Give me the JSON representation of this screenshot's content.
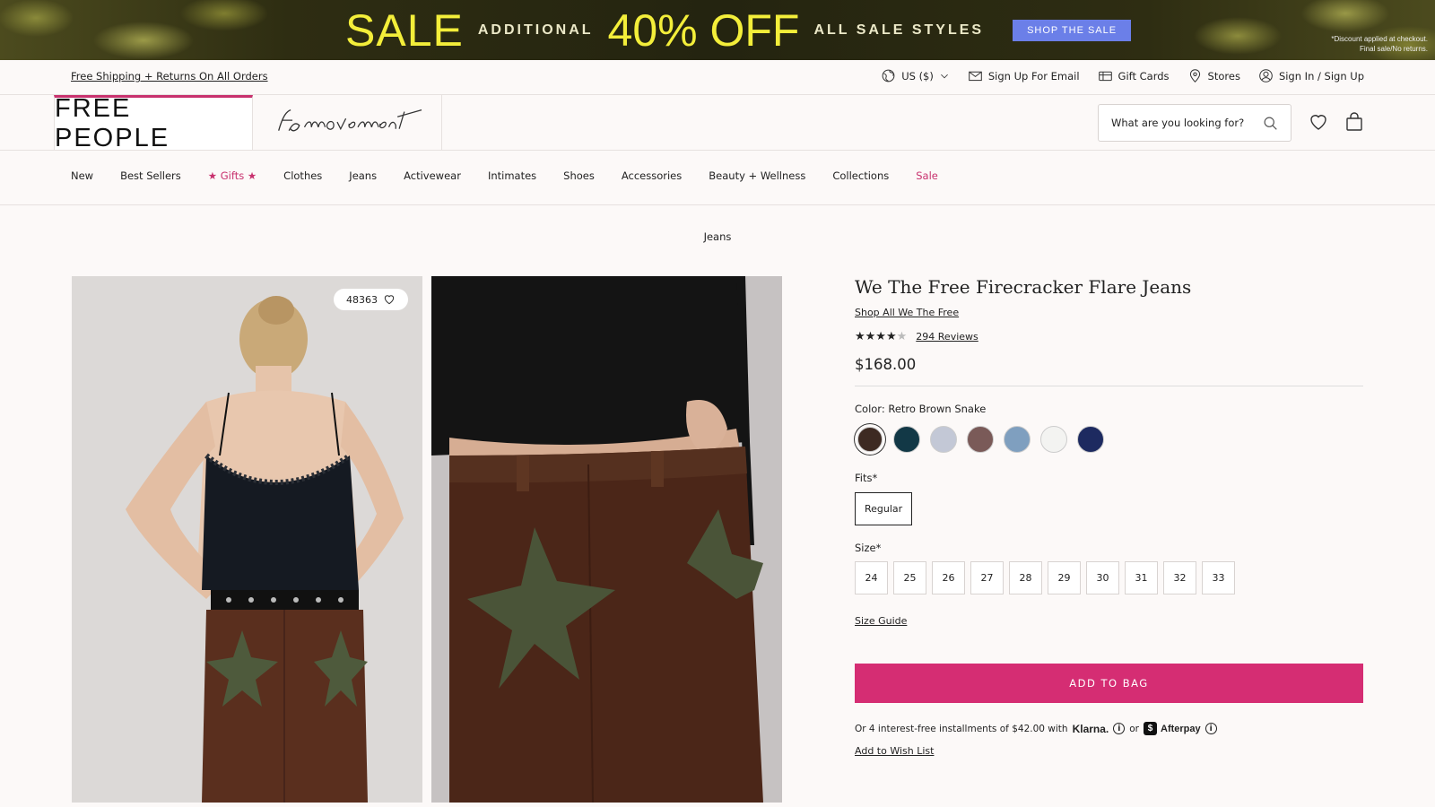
{
  "promo": {
    "sale_word": "SALE",
    "additional": "ADDITIONAL",
    "discount": "40% OFF",
    "all_styles": "ALL SALE STYLES",
    "button": "SHOP THE SALE",
    "note_line1": "*Discount applied at checkout.",
    "note_line2": "Final sale/No returns."
  },
  "utility": {
    "shipping": "Free Shipping + Returns On All Orders",
    "currency": "US ($)",
    "email": "Sign Up For Email",
    "gift_cards": "Gift Cards",
    "stores": "Stores",
    "sign_in": "Sign In / Sign Up"
  },
  "header": {
    "logo": "FREE PEOPLE",
    "movement_logo": "fp movement",
    "search_placeholder": "What are you looking for?"
  },
  "nav": {
    "items": [
      "New",
      "Best Sellers",
      "★ Gifts ★",
      "Clothes",
      "Jeans",
      "Activewear",
      "Intimates",
      "Shoes",
      "Accessories",
      "Beauty + Wellness",
      "Collections",
      "Sale"
    ]
  },
  "breadcrumb": "Jeans",
  "gallery": {
    "likes": "48363"
  },
  "product": {
    "title": "We The Free Firecracker Flare Jeans",
    "shop_all": "Shop All We The Free",
    "rating": 4,
    "rating_max": 5,
    "reviews": "294 Reviews",
    "price": "$168.00",
    "color_label": "Color: Retro Brown Snake",
    "swatches": [
      "#3d2a22",
      "#123846",
      "#c3c8d6",
      "#7a5a58",
      "#7f9fbf",
      "#f3f3f1",
      "#1d2a60"
    ],
    "fits_label": "Fits*",
    "fit_selected": "Regular",
    "size_label": "Size*",
    "sizes": [
      "24",
      "25",
      "26",
      "27",
      "28",
      "29",
      "30",
      "31",
      "32",
      "33"
    ],
    "size_guide": "Size Guide",
    "add_to_bag": "ADD TO BAG",
    "installments_text": "Or 4 interest-free installments of $42.00 with",
    "klarna": "Klarna.",
    "or": "or",
    "afterpay": "Afterpay",
    "wishlist": "Add to Wish List"
  },
  "colors": {
    "accent": "#d52d73",
    "nav_highlight": "#c8316e",
    "promo_yellow": "#f3ee3a",
    "promo_button": "#6b7fe8"
  }
}
